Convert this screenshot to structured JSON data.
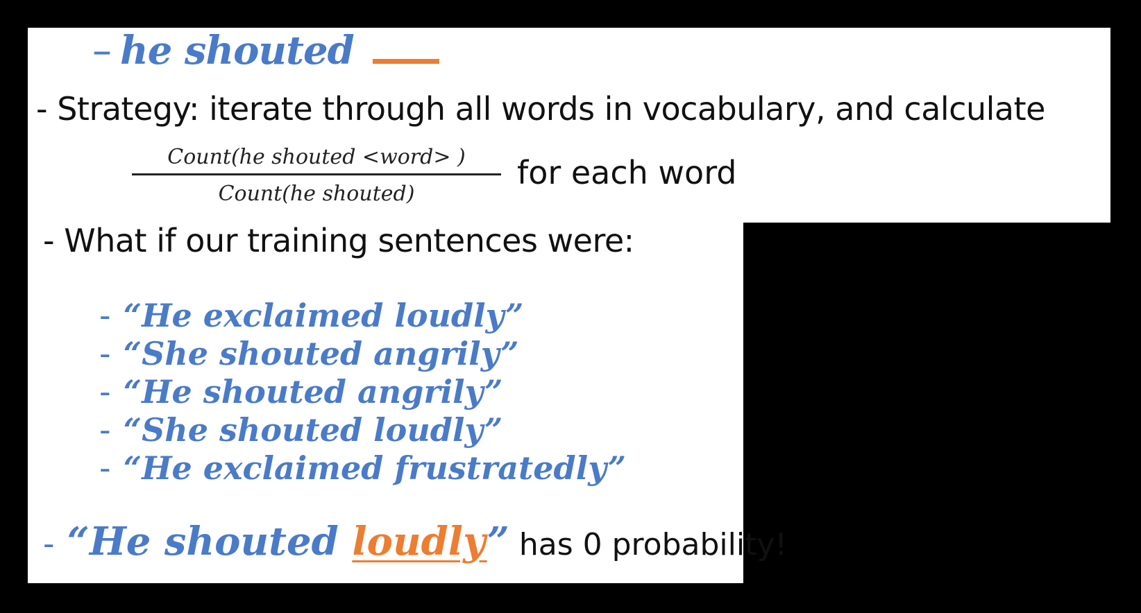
{
  "colors": {
    "blue": "#4a7bc8",
    "orange": "#ed7d31",
    "text": "#111111",
    "background": "#000000",
    "panel": "#ffffff"
  },
  "header": {
    "dash": "–",
    "phrase": "he shouted"
  },
  "strategy": {
    "text": "-  Strategy: iterate through all words in vocabulary, and calculate",
    "fraction_numerator": "Count(he shouted <word> )",
    "fraction_denominator": "Count(he shouted)",
    "suffix": "for each word"
  },
  "question": {
    "text": "-  What if our training sentences were:"
  },
  "sentences": [
    "“He exclaimed loudly”",
    "“She shouted angrily”",
    "“He shouted angrily”",
    "“She shouted loudly”",
    "“He exclaimed frustratedly”"
  ],
  "sentence_dash": "-",
  "conclusion": {
    "dash": "-",
    "open": "“He shouted ",
    "highlight": "loudly",
    "close": "”",
    "tail": " has 0 probability!"
  }
}
